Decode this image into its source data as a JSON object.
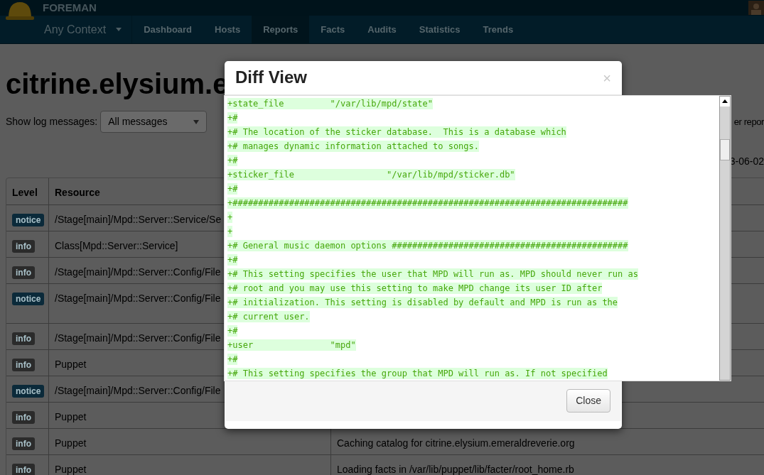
{
  "navbar": {
    "brand": "FOREMAN",
    "context": "Any Context",
    "items": [
      {
        "label": "Dashboard",
        "selected": false
      },
      {
        "label": "Hosts",
        "selected": false
      },
      {
        "label": "Reports",
        "selected": true
      },
      {
        "label": "Facts",
        "selected": false
      },
      {
        "label": "Audits",
        "selected": false
      },
      {
        "label": "Statistics",
        "selected": false
      },
      {
        "label": "Trends",
        "selected": false
      }
    ]
  },
  "page": {
    "heading": "citrine.elysium.e",
    "filter_label": "Show log messages:",
    "filter_value": "All messages",
    "button_fragment": "er repor",
    "date_fragment": "3-06-02"
  },
  "table": {
    "columns": [
      "Level",
      "Resource"
    ],
    "rows": [
      {
        "level": "notice",
        "color": "#0b2a3a",
        "resource": "/Stage[main]/Mpd::Server::Service/Se"
      },
      {
        "level": "info",
        "color": "#2b2b2b",
        "resource": "Class[Mpd::Server::Service]"
      },
      {
        "level": "info",
        "color": "#2b2b2b",
        "resource": "/Stage[main]/Mpd::Server::Config/File"
      },
      {
        "level": "notice",
        "color": "#0b2a3a",
        "resource": "/Stage[main]/Mpd::Server::Config/File",
        "tall": true
      },
      {
        "level": "info",
        "color": "#2b2b2b",
        "resource": "/Stage[main]/Mpd::Server::Config/File"
      },
      {
        "level": "info",
        "color": "#2b2b2b",
        "resource": "Puppet"
      },
      {
        "level": "notice",
        "color": "#0b2a3a",
        "resource": "/Stage[main]/Mpd::Server::Config/File"
      },
      {
        "level": "info",
        "color": "#2b2b2b",
        "resource": "Puppet"
      },
      {
        "level": "info",
        "color": "#2b2b2b",
        "resource": "Puppet",
        "message": "Caching catalog for citrine.elysium.emeraldreverie.org"
      },
      {
        "level": "info",
        "color": "#2b2b2b",
        "resource": "Puppet",
        "message": "Loading facts in /var/lib/puppet/lib/facter/root_home.rb"
      }
    ]
  },
  "modal": {
    "title": "Diff View",
    "close_symbol": "×",
    "button": "Close",
    "lines": [
      "+state_file         \"/var/lib/mpd/state\"",
      "+#",
      "+# The location of the sticker database.  This is a database which",
      "+# manages dynamic information attached to songs.",
      "+#",
      "+sticker_file                  \"/var/lib/mpd/sticker.db\"",
      "+#",
      "+#############################################################################",
      "+",
      "+",
      "+# General music daemon options ##############################################",
      "+#",
      "+# This setting specifies the user that MPD will run as. MPD should never run as",
      "+# root and you may use this setting to make MPD change its user ID after",
      "+# initialization. This setting is disabled by default and MPD is run as the",
      "+# current user.",
      "+#",
      "+user               \"mpd\"",
      "+#",
      "+# This setting specifies the group that MPD will run as. If not specified"
    ]
  }
}
